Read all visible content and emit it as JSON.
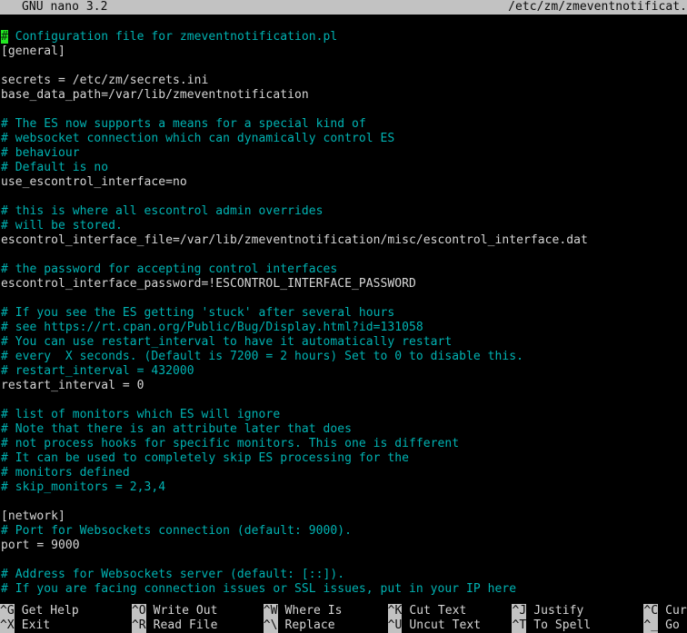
{
  "titlebar": {
    "version": "GNU nano 3.2",
    "filename": "/etc/zm/zmeventnotificat."
  },
  "editor": {
    "cursor_char": "#",
    "lines": [
      {
        "kind": "comment",
        "cursor": true,
        "head": "#",
        "text": " Configuration file for zmeventnotification.pl"
      },
      {
        "kind": "plain",
        "text": "[general]"
      },
      {
        "kind": "blank",
        "text": ""
      },
      {
        "kind": "plain",
        "text": "secrets = /etc/zm/secrets.ini"
      },
      {
        "kind": "plain",
        "text": "base_data_path=/var/lib/zmeventnotification"
      },
      {
        "kind": "blank",
        "text": ""
      },
      {
        "kind": "comment",
        "text": "# The ES now supports a means for a special kind of"
      },
      {
        "kind": "comment",
        "text": "# websocket connection which can dynamically control ES"
      },
      {
        "kind": "comment",
        "text": "# behaviour"
      },
      {
        "kind": "comment",
        "text": "# Default is no"
      },
      {
        "kind": "plain",
        "text": "use_escontrol_interface=no"
      },
      {
        "kind": "blank",
        "text": ""
      },
      {
        "kind": "comment",
        "text": "# this is where all escontrol admin overrides"
      },
      {
        "kind": "comment",
        "text": "# will be stored."
      },
      {
        "kind": "plain",
        "text": "escontrol_interface_file=/var/lib/zmeventnotification/misc/escontrol_interface.dat"
      },
      {
        "kind": "blank",
        "text": ""
      },
      {
        "kind": "comment",
        "text": "# the password for accepting control interfaces"
      },
      {
        "kind": "plain",
        "text": "escontrol_interface_password=!ESCONTROL_INTERFACE_PASSWORD"
      },
      {
        "kind": "blank",
        "text": ""
      },
      {
        "kind": "comment",
        "text": "# If you see the ES getting 'stuck' after several hours"
      },
      {
        "kind": "comment",
        "text": "# see https://rt.cpan.org/Public/Bug/Display.html?id=131058"
      },
      {
        "kind": "comment",
        "text": "# You can use restart_interval to have it automatically restart"
      },
      {
        "kind": "comment",
        "text": "# every  X seconds. (Default is 7200 = 2 hours) Set to 0 to disable this."
      },
      {
        "kind": "comment",
        "text": "# restart_interval = 432000"
      },
      {
        "kind": "plain",
        "text": "restart_interval = 0"
      },
      {
        "kind": "blank",
        "text": ""
      },
      {
        "kind": "comment",
        "text": "# list of monitors which ES will ignore"
      },
      {
        "kind": "comment",
        "text": "# Note that there is an attribute later that does"
      },
      {
        "kind": "comment",
        "text": "# not process hooks for specific monitors. This one is different"
      },
      {
        "kind": "comment",
        "text": "# It can be used to completely skip ES processing for the"
      },
      {
        "kind": "comment",
        "text": "# monitors defined"
      },
      {
        "kind": "comment",
        "text": "# skip_monitors = 2,3,4"
      },
      {
        "kind": "blank",
        "text": ""
      },
      {
        "kind": "plain",
        "text": "[network]"
      },
      {
        "kind": "comment",
        "text": "# Port for Websockets connection (default: 9000)."
      },
      {
        "kind": "plain",
        "text": "port = 9000"
      },
      {
        "kind": "blank",
        "text": ""
      },
      {
        "kind": "comment",
        "text": "# Address for Websockets server (default: [::])."
      },
      {
        "kind": "comment",
        "text": "# If you are facing connection issues or SSL issues, put in your IP here"
      }
    ]
  },
  "shortcuts": {
    "row1": [
      {
        "key": "^G",
        "label": "Get Help"
      },
      {
        "key": "^O",
        "label": "Write Out"
      },
      {
        "key": "^W",
        "label": "Where Is"
      },
      {
        "key": "^K",
        "label": "Cut Text"
      },
      {
        "key": "^J",
        "label": "Justify"
      },
      {
        "key": "^C",
        "label": "Cur Pos"
      }
    ],
    "row2": [
      {
        "key": "^X",
        "label": "Exit"
      },
      {
        "key": "^R",
        "label": "Read File"
      },
      {
        "key": "^\\",
        "label": "Replace"
      },
      {
        "key": "^U",
        "label": "Uncut Text"
      },
      {
        "key": "^T",
        "label": "To Spell"
      },
      {
        "key": "^_",
        "label": "Go To Line"
      }
    ]
  },
  "colors": {
    "background": "#000000",
    "bar_background": "#c2c2c2",
    "bar_text": "#0b0b0b",
    "comment_text": "#00b3b3",
    "plain_text": "#d6d6d6",
    "cursor_background": "#22e522"
  }
}
